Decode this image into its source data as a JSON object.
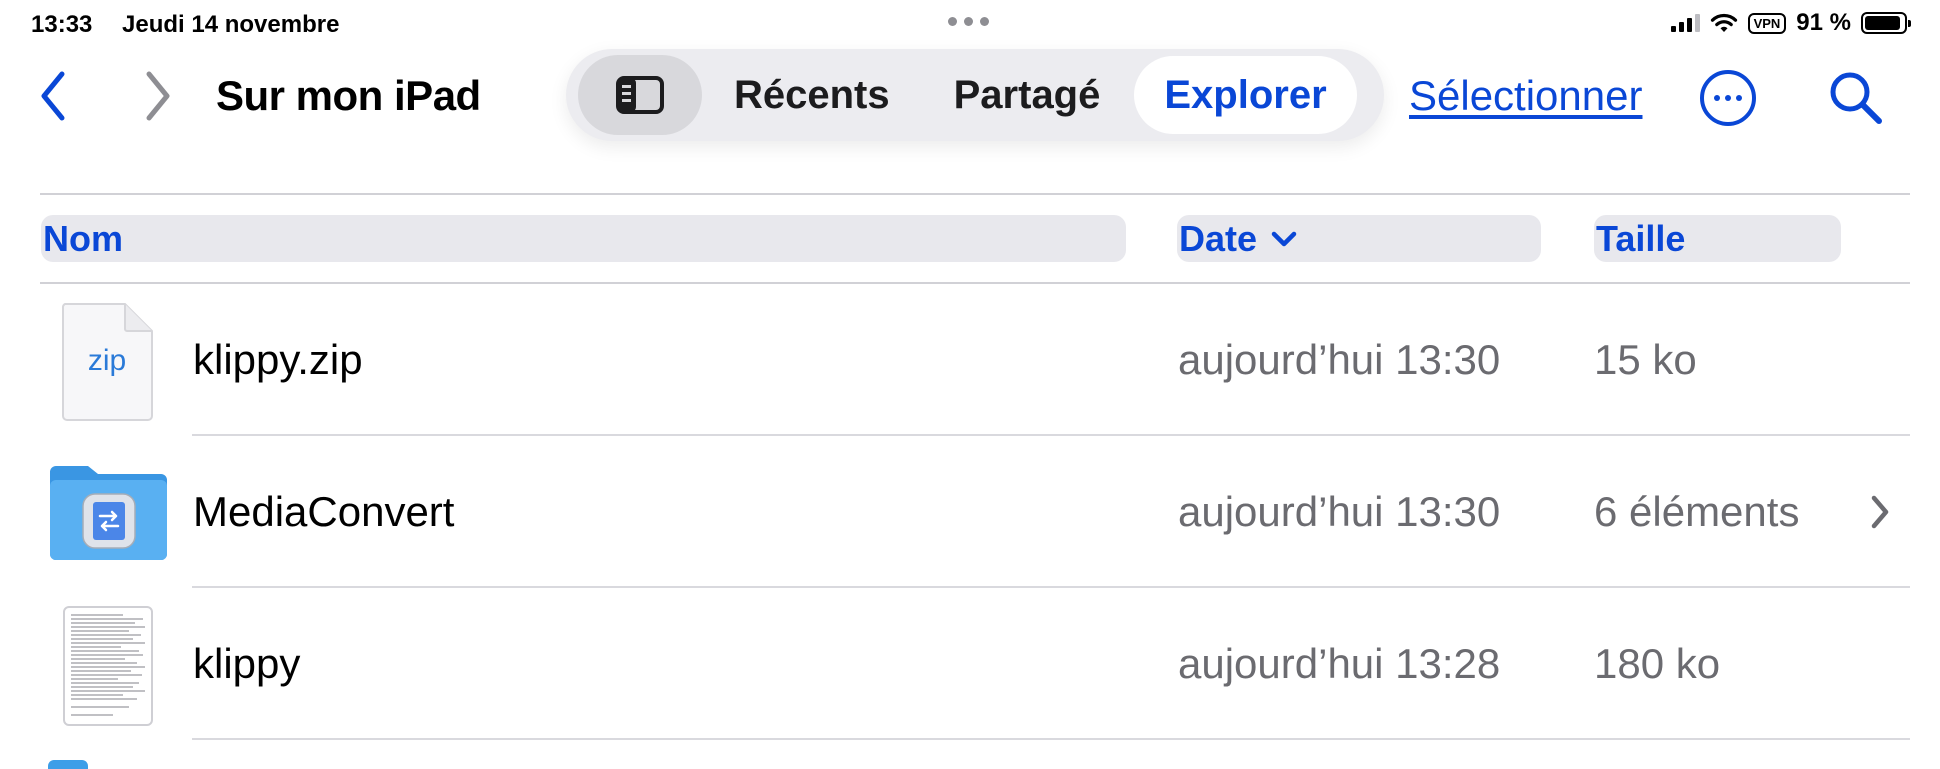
{
  "status_bar": {
    "time": "13:33",
    "date": "Jeudi 14 novembre",
    "vpn": "VPN",
    "battery_pct": "91 %",
    "battery_level": 0.91
  },
  "toolbar": {
    "title": "Sur mon iPad",
    "tabs": [
      {
        "label": "Récents",
        "active": false
      },
      {
        "label": "Partagé",
        "active": false
      },
      {
        "label": "Explorer",
        "active": true
      }
    ],
    "select_label": "Sélectionner"
  },
  "columns": {
    "name": "Nom",
    "date": "Date",
    "size": "Taille"
  },
  "rows": [
    {
      "name": "klippy.zip",
      "date": "aujourd’hui 13:30",
      "size": "15 ko",
      "icon": "zip-file-icon",
      "icon_text": "zip"
    },
    {
      "name": "MediaConvert",
      "date": "aujourd’hui 13:30",
      "size": "6 éléments",
      "icon": "folder-icon"
    },
    {
      "name": "klippy",
      "date": "aujourd’hui 13:28",
      "size": "180 ko",
      "icon": "document-icon"
    }
  ],
  "colors": {
    "accent": "#0a47d6",
    "secondary_text": "#6b6b70",
    "folder": "#3d9ee8"
  }
}
